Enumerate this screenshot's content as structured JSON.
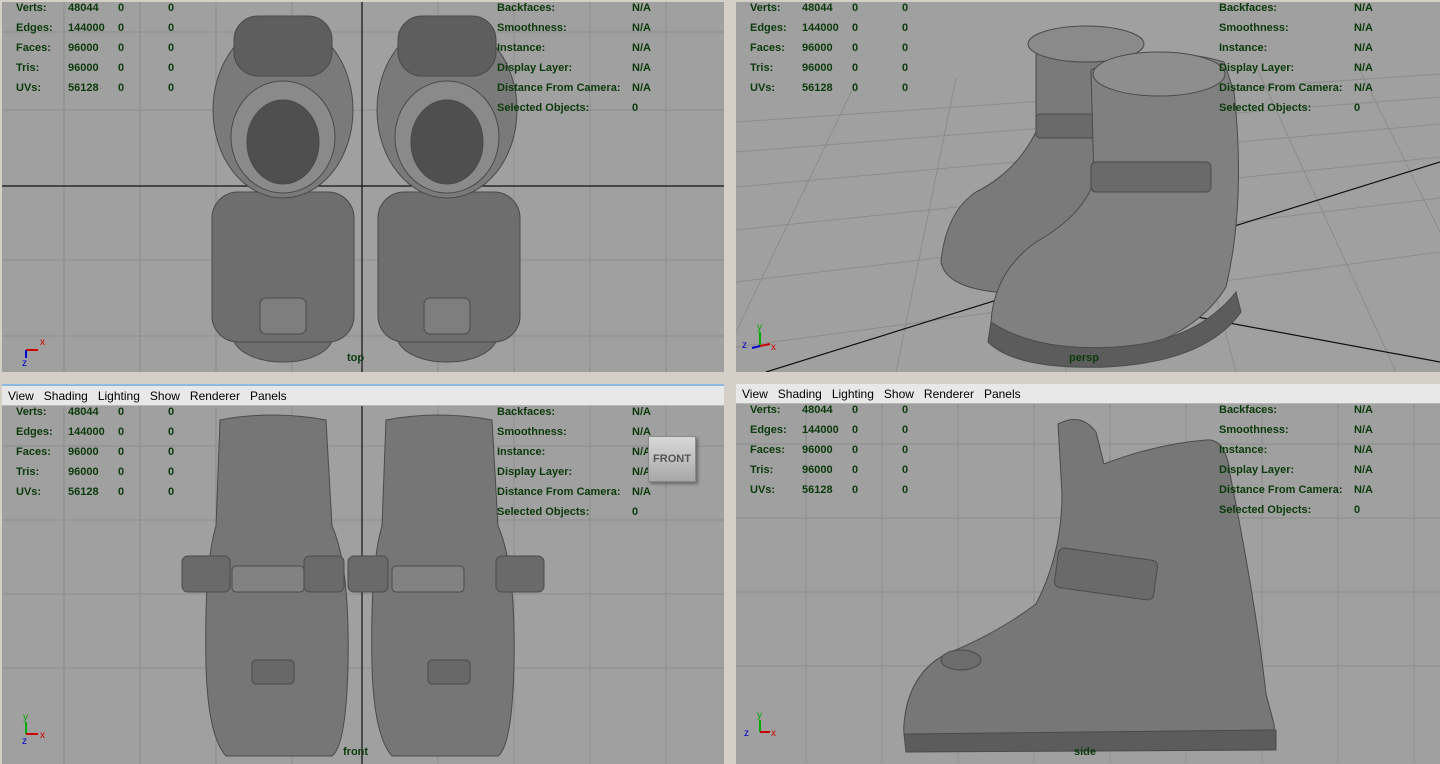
{
  "menu": {
    "view": "View",
    "shading": "Shading",
    "lighting": "Lighting",
    "show": "Show",
    "renderer": "Renderer",
    "panels": "Panels"
  },
  "stats": {
    "verts": {
      "label": "Verts:",
      "value": "48044",
      "a": "0",
      "b": "0"
    },
    "edges": {
      "label": "Edges:",
      "value": "144000",
      "a": "0",
      "b": "0"
    },
    "faces": {
      "label": "Faces:",
      "value": "96000",
      "a": "0",
      "b": "0"
    },
    "tris": {
      "label": "Tris:",
      "value": "96000",
      "a": "0",
      "b": "0"
    },
    "uvs": {
      "label": "UVs:",
      "value": "56128",
      "a": "0",
      "b": "0"
    }
  },
  "info": {
    "backfaces": {
      "label": "Backfaces:",
      "value": "N/A"
    },
    "smoothness": {
      "label": "Smoothness:",
      "value": "N/A"
    },
    "instance": {
      "label": "Instance:",
      "value": "N/A"
    },
    "display_layer": {
      "label": "Display Layer:",
      "value": "N/A"
    },
    "distance": {
      "label": "Distance From Camera:",
      "value": "N/A"
    },
    "selected": {
      "label": "Selected Objects:",
      "value": "0"
    }
  },
  "viewports": {
    "top": {
      "name": "top",
      "axis_y": "",
      "axis_x": "x",
      "axis_z": "z"
    },
    "persp": {
      "name": "persp",
      "axis_y": "y",
      "axis_x": "x",
      "axis_z": "z"
    },
    "front": {
      "name": "front",
      "axis_y": "y",
      "axis_x": "x",
      "axis_z": "z",
      "cube": "FRONT"
    },
    "side": {
      "name": "side",
      "axis_y": "y",
      "axis_x": "x",
      "axis_z": "z"
    }
  },
  "colors": {
    "viewport_bg": "#a0a0a0",
    "grid": "#8c8c8c",
    "axis_line": "#111111",
    "hud_text": "#0b3a0b",
    "model": "#6e6e6e"
  }
}
